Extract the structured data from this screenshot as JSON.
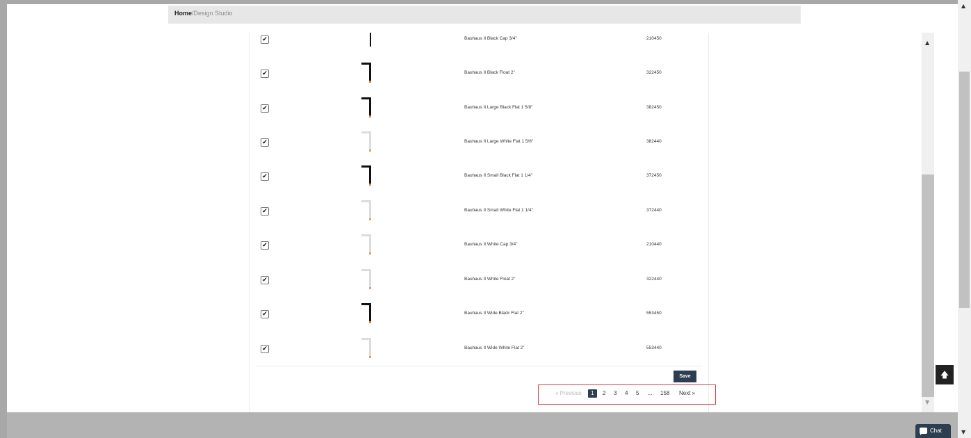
{
  "breadcrumb": {
    "home": "Home",
    "separator": "/",
    "current": "Design Studio"
  },
  "products": [
    {
      "name": "Bauhaus II Black Cap 3/4\"",
      "sku": "210450",
      "checked": true,
      "color": "black-thin"
    },
    {
      "name": "Bauhaus II Black Float 2\"",
      "sku": "322450",
      "checked": true,
      "color": "black"
    },
    {
      "name": "Bauhaus II Large Black Flat 1 5/8\"",
      "sku": "382450",
      "checked": true,
      "color": "black"
    },
    {
      "name": "Bauhaus II Large White Flat 1 5/8\"",
      "sku": "382440",
      "checked": true,
      "color": "white"
    },
    {
      "name": "Bauhaus II Small Black Flat 1 1/4\"",
      "sku": "372450",
      "checked": true,
      "color": "black"
    },
    {
      "name": "Bauhaus II Small White Flat 1 1/4\"",
      "sku": "372440",
      "checked": true,
      "color": "white"
    },
    {
      "name": "Bauhaus II White Cap 3/4\"",
      "sku": "210440",
      "checked": true,
      "color": "white"
    },
    {
      "name": "Bauhaus II White Float 2\"",
      "sku": "322440",
      "checked": true,
      "color": "white"
    },
    {
      "name": "Bauhaus II Wide Black Flat 2\"",
      "sku": "553450",
      "checked": true,
      "color": "black"
    },
    {
      "name": "Bauhaus II Wide White Flat 2\"",
      "sku": "553440",
      "checked": true,
      "color": "white"
    }
  ],
  "checkbox_glyph": "✔",
  "save_label": "Save",
  "pagination": {
    "previous": "« Previous",
    "pages": [
      "1",
      "2",
      "3",
      "4",
      "5"
    ],
    "active": "1",
    "ellipsis": "…",
    "last": "158",
    "next": "Next »"
  },
  "chat_label": "Chat",
  "back_to_top_glyph": "🡅",
  "scroll_up_glyph": "▲",
  "scroll_down_glyph": "▼",
  "colors": {
    "accent": "#2c3e50",
    "highlight": "#e84141"
  }
}
